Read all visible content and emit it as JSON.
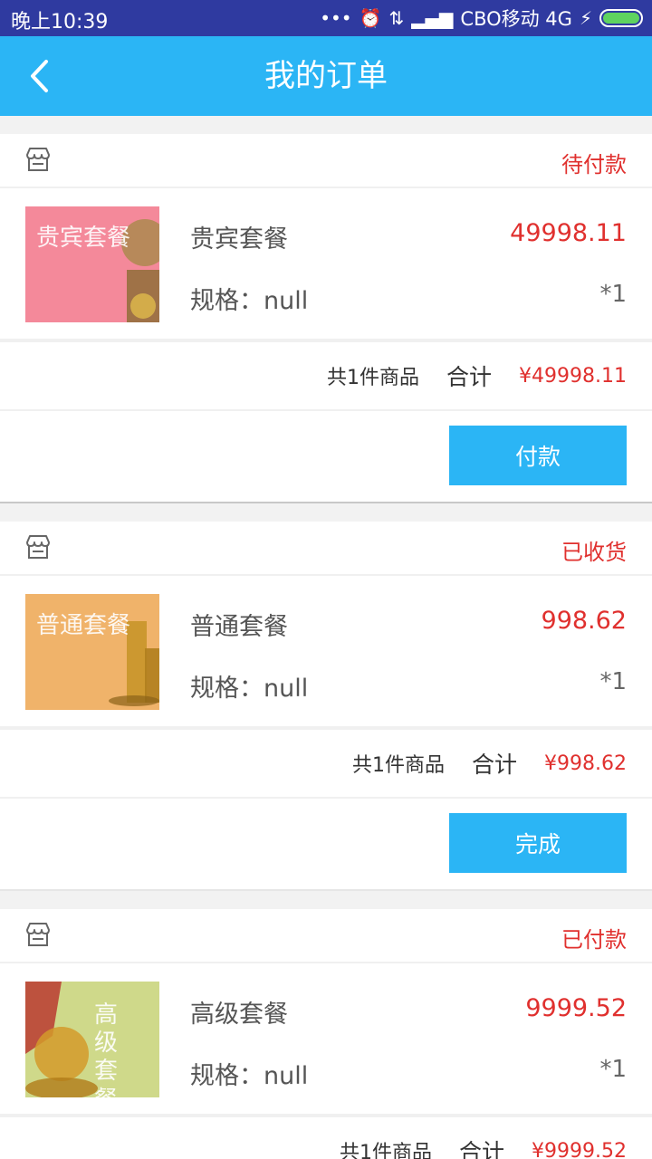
{
  "status_bar": {
    "time": "晚上10:39",
    "icons": [
      "more-dots-icon",
      "alarm-icon",
      "data-arrows-icon",
      "signal-icon"
    ],
    "carrier": "CBO移动 4G",
    "battery_level": 1.0
  },
  "header": {
    "back_icon": "chevron-left-icon",
    "title": "我的订单"
  },
  "orders": [
    {
      "status": "待付款",
      "status_color": "#e0302e",
      "product": {
        "name": "贵宾套餐",
        "price": "49998.11",
        "spec": "规格：null",
        "qty": "*1",
        "thumb_text": "贵宾套餐",
        "thumb_color": "#f4899a"
      },
      "summary": {
        "count": "共1件商品",
        "label": "合计",
        "total": "¥49998.11"
      },
      "action": "付款"
    },
    {
      "status": "已收货",
      "status_color": "#e0302e",
      "product": {
        "name": "普通套餐",
        "price": "998.62",
        "spec": "规格：null",
        "qty": "*1",
        "thumb_text": "普通套餐",
        "thumb_color": "#f0b36a"
      },
      "summary": {
        "count": "共1件商品",
        "label": "合计",
        "total": "¥998.62"
      },
      "action": "完成"
    },
    {
      "status": "已付款",
      "status_color": "#e0302e",
      "product": {
        "name": "高级套餐",
        "price": "9999.52",
        "spec": "规格：null",
        "qty": "*1",
        "thumb_text": "高级套餐",
        "thumb_color": "#cfd98a"
      },
      "summary": {
        "count": "共1件商品",
        "label": "合计",
        "total": "¥9999.52"
      },
      "action": ""
    }
  ],
  "colors": {
    "accent": "#2bb5f5",
    "price_red": "#e0302e",
    "status_bar": "#2f3aa0"
  }
}
